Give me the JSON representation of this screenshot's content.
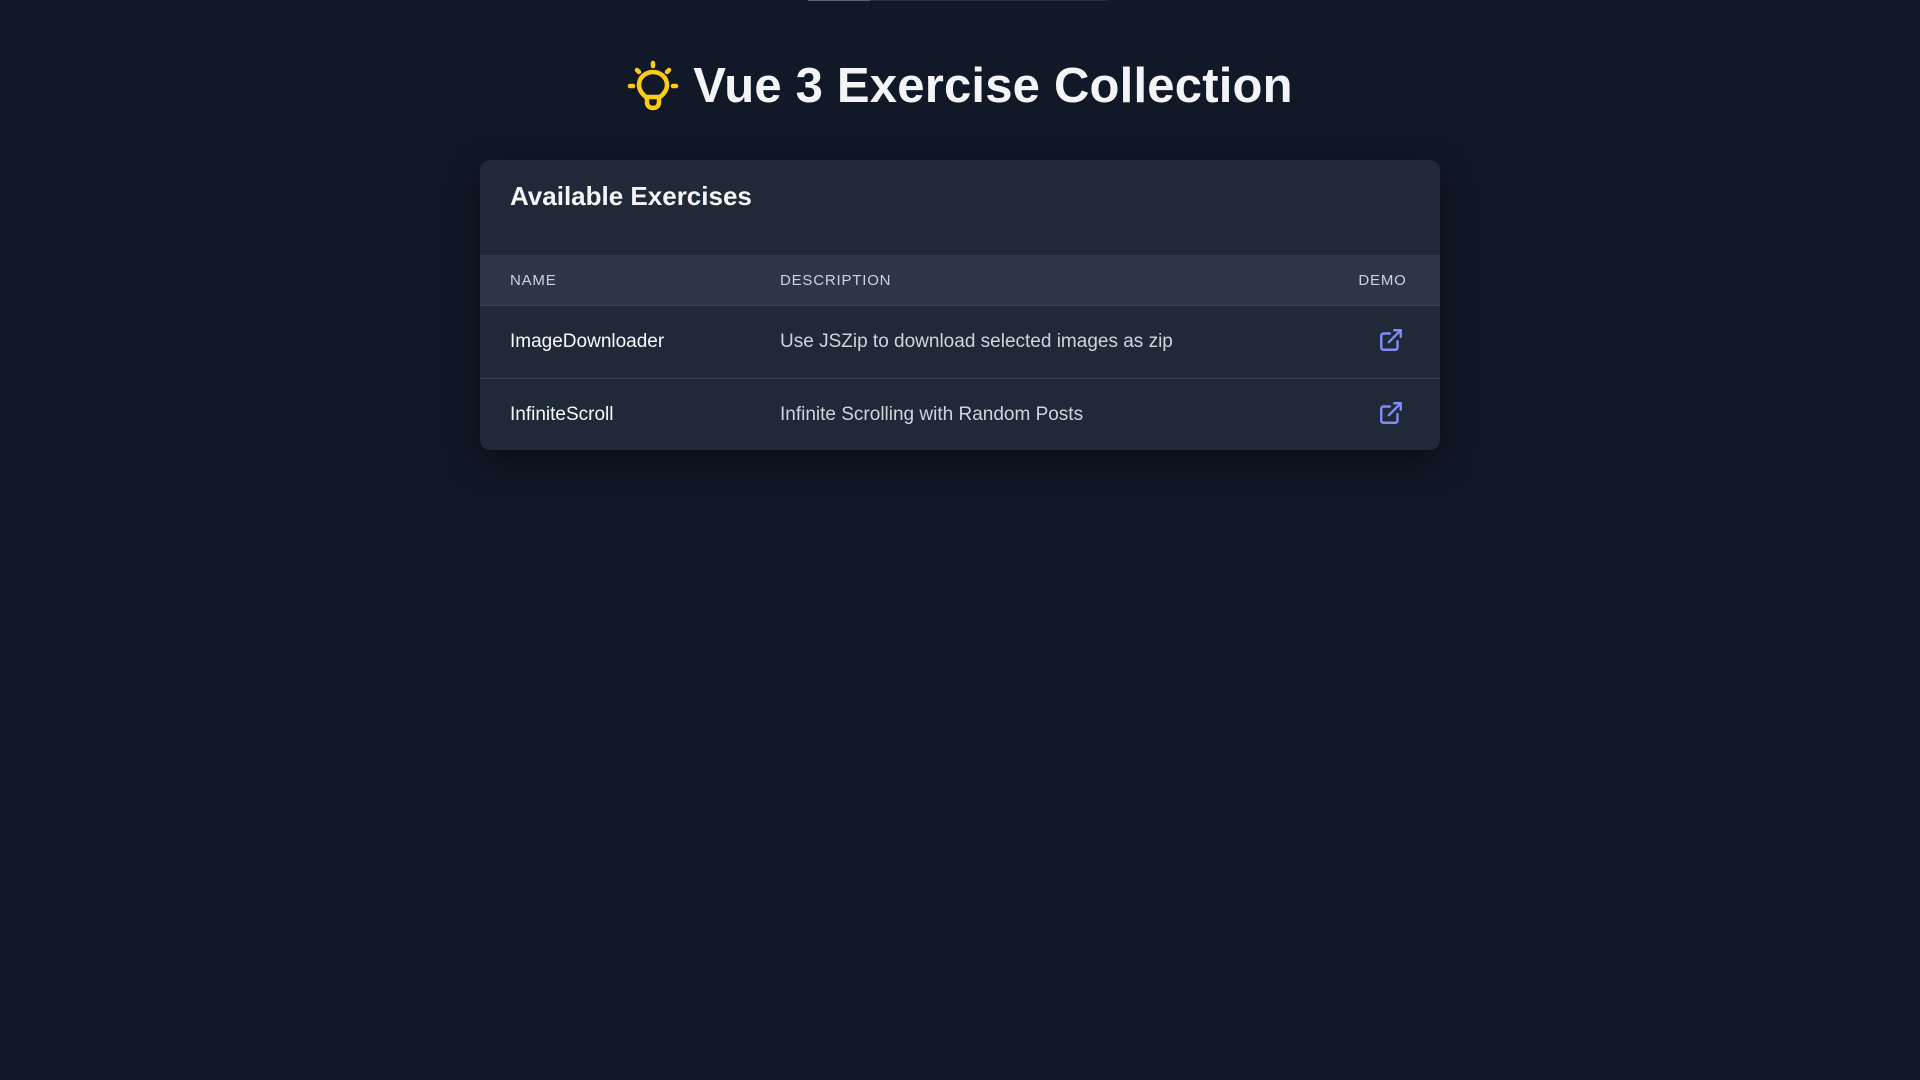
{
  "page": {
    "title": "Vue 3 Exercise Collection",
    "title_icon": "lightbulb-icon",
    "accent_color": "#facc15",
    "link_color": "#818cf8"
  },
  "card": {
    "heading": "Available Exercises",
    "columns": [
      "NAME",
      "DESCRIPTION",
      "DEMO"
    ],
    "rows": [
      {
        "name": "ImageDownloader",
        "description": "Use JSZip to download selected images as zip",
        "demo_icon": "external-link-icon"
      },
      {
        "name": "InfiniteScroll",
        "description": "Infinite Scrolling with Random Posts",
        "demo_icon": "external-link-icon"
      }
    ]
  }
}
